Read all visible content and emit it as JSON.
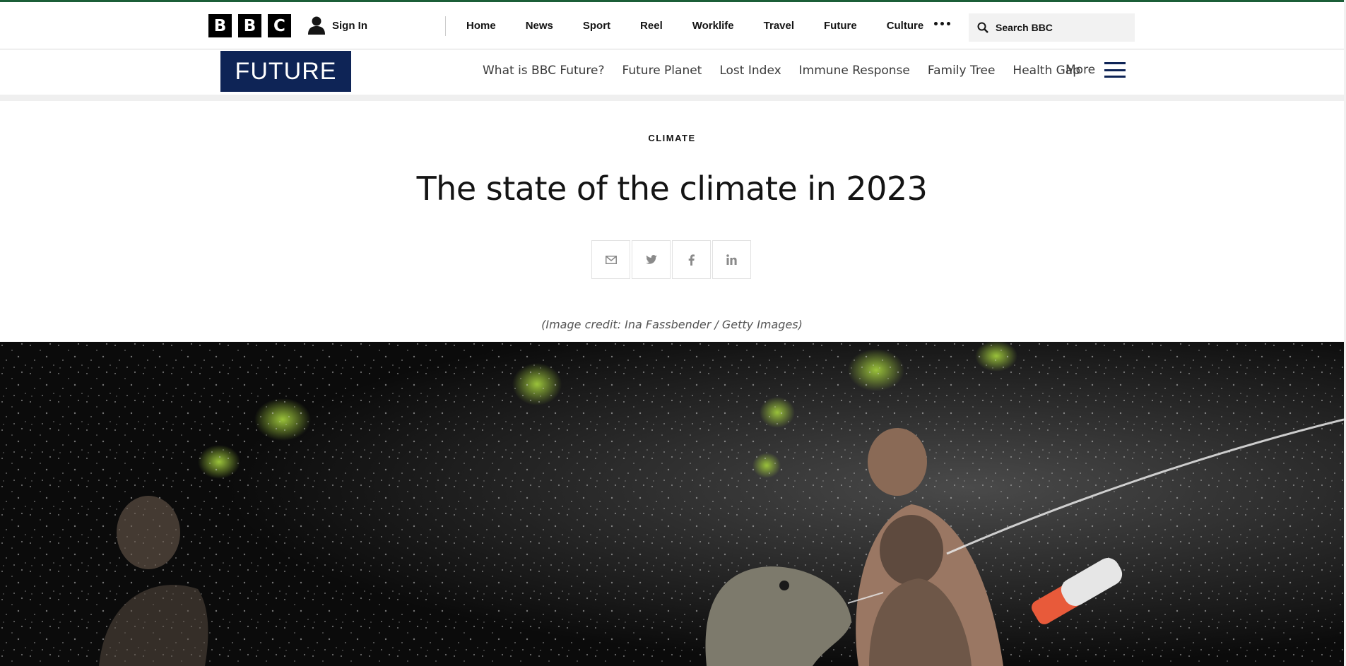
{
  "topbar": {
    "logo_letters": [
      "B",
      "B",
      "C"
    ],
    "signin_label": "Sign In",
    "nav": [
      "Home",
      "News",
      "Sport",
      "Reel",
      "Worklife",
      "Travel",
      "Future",
      "Culture"
    ],
    "search_placeholder": "Search BBC"
  },
  "futurebar": {
    "logo": "FUTURE",
    "subnav": [
      "What is BBC Future?",
      "Future Planet",
      "Lost Index",
      "Immune Response",
      "Family Tree",
      "Health Gap"
    ],
    "more_label": "More"
  },
  "article": {
    "category": "CLIMATE",
    "headline": "The state of the climate in 2023",
    "share_icons": [
      "email-icon",
      "twitter-icon",
      "facebook-icon",
      "linkedin-icon"
    ],
    "image_credit": "(Image credit: Ina Fassbender / Getty Images)"
  },
  "colors": {
    "future_navy": "#0e2456",
    "top_border_green": "#1b5e38",
    "text": "#141414"
  }
}
